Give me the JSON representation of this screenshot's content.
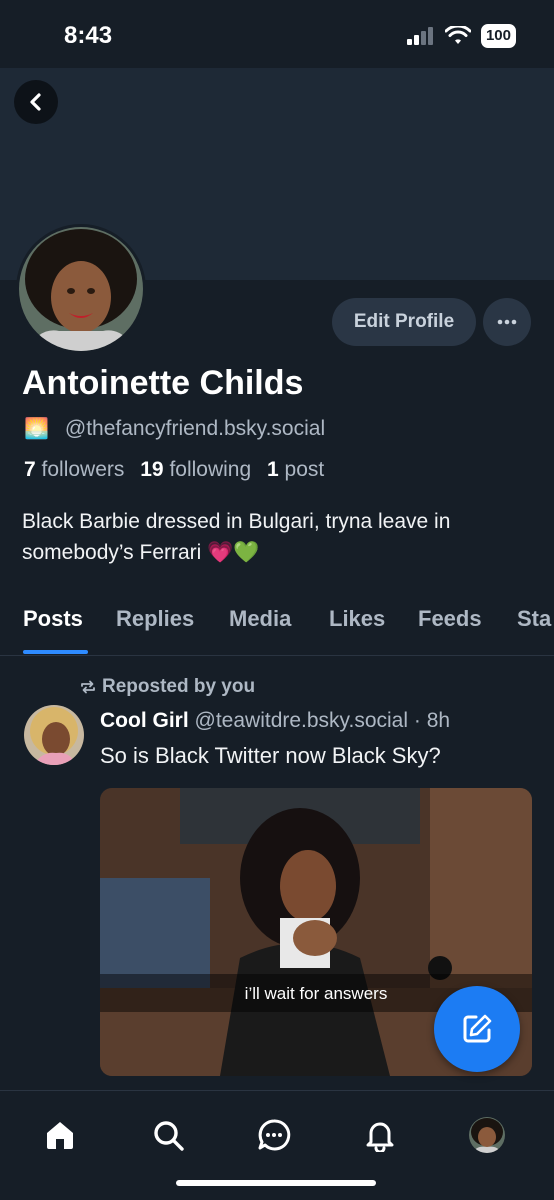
{
  "status": {
    "time": "8:43",
    "battery": "100"
  },
  "profile": {
    "display_name": "Antoinette Childs",
    "handle_emoji": "🌅",
    "handle": "@thefancyfriend.bsky.social",
    "followers_count": "7",
    "followers_label": "followers",
    "following_count": "19",
    "following_label": "following",
    "posts_count": "1",
    "posts_label": "post",
    "bio": "Black Barbie dressed in Bulgari, tryna leave in somebody’s Ferrari 💗💚",
    "edit_button": "Edit Profile"
  },
  "tabs": [
    "Posts",
    "Replies",
    "Media",
    "Likes",
    "Feeds",
    "Sta"
  ],
  "post": {
    "repost_label": "Reposted by you",
    "author": "Cool Girl",
    "author_handle": "@teawitdre.bsky.social",
    "time": "· 8h",
    "text": "So is Black Twitter now Black Sky?",
    "image_caption": "i’ll wait for answers"
  },
  "nav": [
    "home-icon",
    "search-icon",
    "chat-icon",
    "bell-icon",
    "profile-avatar"
  ],
  "colors": {
    "background": "#161e27",
    "banner": "#1e2936",
    "accent": "#2e8bff",
    "fab": "#1c7cf3"
  }
}
